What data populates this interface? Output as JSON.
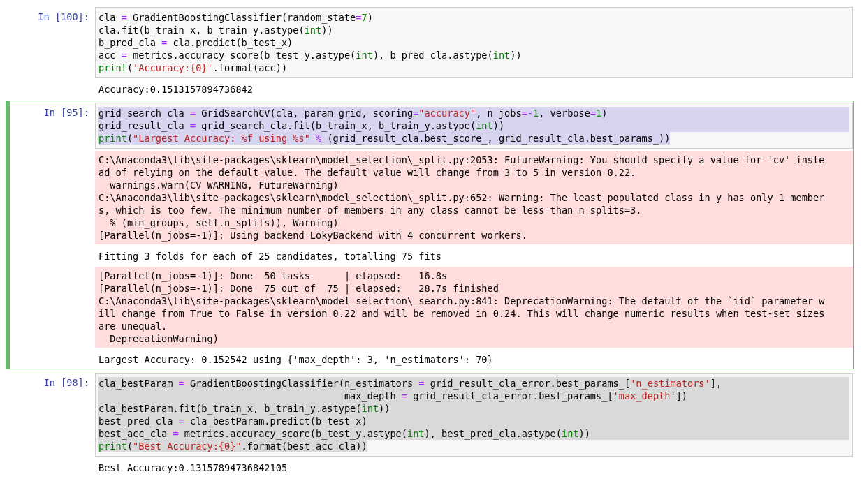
{
  "cells": [
    {
      "prompt": "In [100]:",
      "selected": false,
      "code": [
        {
          "highlighted": false,
          "tokens": [
            {
              "kind": "plain",
              "text": "cla "
            },
            {
              "kind": "op",
              "text": "="
            },
            {
              "kind": "plain",
              "text": " GradientBoostingClassifier(random_state"
            },
            {
              "kind": "op",
              "text": "="
            },
            {
              "kind": "num",
              "text": "7"
            },
            {
              "kind": "plain",
              "text": ")"
            }
          ]
        },
        {
          "highlighted": false,
          "tokens": [
            {
              "kind": "plain",
              "text": "cla.fit(b_train_x, b_train_y.astype("
            },
            {
              "kind": "builtin",
              "text": "int"
            },
            {
              "kind": "plain",
              "text": "))"
            }
          ]
        },
        {
          "highlighted": false,
          "tokens": [
            {
              "kind": "plain",
              "text": "b_pred_cla "
            },
            {
              "kind": "op",
              "text": "="
            },
            {
              "kind": "plain",
              "text": " cla.predict(b_test_x)"
            }
          ]
        },
        {
          "highlighted": false,
          "tokens": [
            {
              "kind": "plain",
              "text": "acc "
            },
            {
              "kind": "op",
              "text": "="
            },
            {
              "kind": "plain",
              "text": " metrics.accuracy_score(b_test_y.astype("
            },
            {
              "kind": "builtin",
              "text": "int"
            },
            {
              "kind": "plain",
              "text": "), b_pred_cla.astype("
            },
            {
              "kind": "builtin",
              "text": "int"
            },
            {
              "kind": "plain",
              "text": "))"
            }
          ]
        },
        {
          "highlighted": false,
          "tokens": [
            {
              "kind": "builtin",
              "text": "print"
            },
            {
              "kind": "plain",
              "text": "("
            },
            {
              "kind": "str",
              "text": "'Accuracy:{0}'"
            },
            {
              "kind": "plain",
              "text": ".format(acc))"
            }
          ]
        }
      ],
      "outputs": [
        {
          "kind": "stream",
          "lines": [
            "Accuracy:0.1513157894736842"
          ]
        }
      ]
    },
    {
      "prompt": "In [95]:",
      "selected": true,
      "code": [
        {
          "highlighted": true,
          "tokens": [
            {
              "kind": "plain",
              "text": "grid_search_cla "
            },
            {
              "kind": "op",
              "text": "="
            },
            {
              "kind": "plain",
              "text": " GridSearchCV(cla, param_grid, scoring"
            },
            {
              "kind": "op",
              "text": "="
            },
            {
              "kind": "str",
              "text": "\"accuracy\""
            },
            {
              "kind": "plain",
              "text": ", n_jobs"
            },
            {
              "kind": "op",
              "text": "=-"
            },
            {
              "kind": "num",
              "text": "1"
            },
            {
              "kind": "plain",
              "text": ", verbose"
            },
            {
              "kind": "op",
              "text": "="
            },
            {
              "kind": "num",
              "text": "1"
            },
            {
              "kind": "plain",
              "text": ")"
            }
          ]
        },
        {
          "highlighted": true,
          "tokens": [
            {
              "kind": "plain",
              "text": "grid_result_cla "
            },
            {
              "kind": "op",
              "text": "="
            },
            {
              "kind": "plain",
              "text": " grid_search_cla.fit(b_train_x, b_train_y.astype("
            },
            {
              "kind": "builtin",
              "text": "int"
            },
            {
              "kind": "plain",
              "text": "))"
            }
          ]
        },
        {
          "highlighted": true,
          "tokens": [
            {
              "kind": "builtin",
              "text": "print"
            },
            {
              "kind": "plain",
              "text": "("
            },
            {
              "kind": "str",
              "text": "\"Largest Accuracy: %f using %s\""
            },
            {
              "kind": "op",
              "text": " %"
            },
            {
              "kind": "plain",
              "text": " (grid_result_cla.best_score_, grid_result_cla.best_params_))"
            }
          ]
        }
      ],
      "outputs": [
        {
          "kind": "stderr",
          "lines": [
            "C:\\Anaconda3\\lib\\site-packages\\sklearn\\model_selection\\_split.py:2053: FutureWarning: You should specify a value for 'cv' inste",
            "ad of relying on the default value. The default value will change from 3 to 5 in version 0.22.",
            "  warnings.warn(CV_WARNING, FutureWarning)",
            "C:\\Anaconda3\\lib\\site-packages\\sklearn\\model_selection\\_split.py:652: Warning: The least populated class in y has only 1 member",
            "s, which is too few. The minimum number of members in any class cannot be less than n_splits=3.",
            "  % (min_groups, self.n_splits)), Warning)",
            "[Parallel(n_jobs=-1)]: Using backend LokyBackend with 4 concurrent workers."
          ]
        },
        {
          "kind": "stream",
          "lines": [
            "Fitting 3 folds for each of 25 candidates, totalling 75 fits"
          ]
        },
        {
          "kind": "stderr",
          "lines": [
            "[Parallel(n_jobs=-1)]: Done  50 tasks      | elapsed:   16.8s",
            "[Parallel(n_jobs=-1)]: Done  75 out of  75 | elapsed:   28.7s finished",
            "C:\\Anaconda3\\lib\\site-packages\\sklearn\\model_selection\\_search.py:841: DeprecationWarning: The default of the `iid` parameter w",
            "ill change from True to False in version 0.22 and will be removed in 0.24. This will change numeric results when test-set sizes",
            "are unequal.",
            "  DeprecationWarning)"
          ]
        },
        {
          "kind": "stream",
          "lines": [
            "Largest Accuracy: 0.152542 using {'max_depth': 3, 'n_estimators': 70}"
          ]
        }
      ]
    },
    {
      "prompt": "In [98]:",
      "selected": false,
      "code": [
        {
          "highlighted": true,
          "tokens": [
            {
              "kind": "plain",
              "text": "cla_bestParam "
            },
            {
              "kind": "op",
              "text": "="
            },
            {
              "kind": "plain",
              "text": " GradientBoostingClassifier(n_estimators "
            },
            {
              "kind": "op",
              "text": "="
            },
            {
              "kind": "plain",
              "text": " grid_result_cla_error.best_params_["
            },
            {
              "kind": "str",
              "text": "'n_estimators'"
            },
            {
              "kind": "plain",
              "text": "],"
            }
          ]
        },
        {
          "highlighted": true,
          "tokens": [
            {
              "kind": "plain",
              "text": "                                           max_depth "
            },
            {
              "kind": "op",
              "text": "="
            },
            {
              "kind": "plain",
              "text": " grid_result_cla_error.best_params_["
            },
            {
              "kind": "str",
              "text": "'max_depth'"
            },
            {
              "kind": "plain",
              "text": "])"
            }
          ]
        },
        {
          "highlighted": true,
          "tokens": [
            {
              "kind": "plain",
              "text": "cla_bestParam.fit(b_train_x, b_train_y.astype("
            },
            {
              "kind": "builtin",
              "text": "int"
            },
            {
              "kind": "plain",
              "text": "))"
            }
          ]
        },
        {
          "highlighted": true,
          "tokens": [
            {
              "kind": "plain",
              "text": "best_pred_cla "
            },
            {
              "kind": "op",
              "text": "="
            },
            {
              "kind": "plain",
              "text": " cla_bestParam.predict(b_test_x)"
            }
          ]
        },
        {
          "highlighted": true,
          "tokens": [
            {
              "kind": "plain",
              "text": "best_acc_cla "
            },
            {
              "kind": "op",
              "text": "="
            },
            {
              "kind": "plain",
              "text": " metrics.accuracy_score(b_test_y.astype("
            },
            {
              "kind": "builtin",
              "text": "int"
            },
            {
              "kind": "plain",
              "text": "), best_pred_cla.astype("
            },
            {
              "kind": "builtin",
              "text": "int"
            },
            {
              "kind": "plain",
              "text": "))"
            }
          ]
        },
        {
          "highlighted": true,
          "tokens": [
            {
              "kind": "builtin",
              "text": "print"
            },
            {
              "kind": "plain",
              "text": "("
            },
            {
              "kind": "str",
              "text": "\"Best Accuracy:{0}\""
            },
            {
              "kind": "plain",
              "text": ".format(best_acc_cla))"
            }
          ]
        }
      ],
      "outputs": [
        {
          "kind": "stream",
          "lines": [
            "Best Accuracy:0.13157894736842105"
          ]
        }
      ]
    }
  ]
}
